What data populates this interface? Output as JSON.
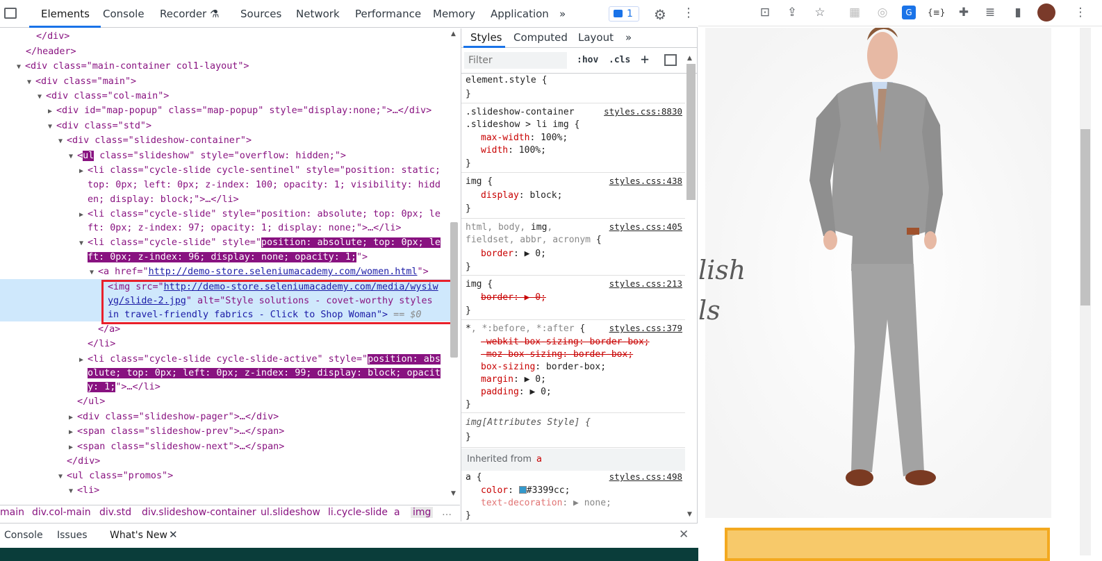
{
  "devtools": {
    "tabs": [
      "Elements",
      "Console",
      "Recorder",
      "Sources",
      "Network",
      "Performance",
      "Memory",
      "Application",
      "»"
    ],
    "issues_count": "1",
    "tree": [
      {
        "t": "</div>"
      },
      {
        "t": "</header>"
      },
      {
        "t": "<div class=\"main-container col1-layout\">"
      },
      {
        "t": "<div class=\"main\">"
      },
      {
        "t": "<div class=\"col-main\">"
      },
      {
        "t": "<div id=\"map-popup\" class=\"map-popup\" style=\"display:none;\">…</div>"
      },
      {
        "t": "<div class=\"std\">"
      },
      {
        "t": "<div class=\"slideshow-container\">"
      },
      {
        "t": "class=\"slideshow\" style=\"overflow: hidden;\">"
      },
      {
        "t": "<li class=\"cycle-slide cycle-sentinel\" style=\"position: static;"
      },
      {
        "t": "top: 0px; left: 0px; z-index: 100; opacity: 1; visibility: hidd"
      },
      {
        "t": "en; display: block;\">…</li>"
      },
      {
        "t": "<li class=\"cycle-slide\" style=\"position: absolute; top: 0px; le"
      },
      {
        "t": "ft: 0px; z-index: 97; opacity: 1; display: none;\">…</li>"
      },
      {
        "t": "<li class=\"cycle-slide\" style=\""
      },
      {
        "t": "position: absolute; top: 0px; le"
      },
      {
        "t": "ft: 0px; z-index: 96; display: none; opacity: 1;"
      },
      {
        "t": "<a href=\""
      },
      {
        "t": "http://demo-store.seleniumacademy.com/women.html"
      },
      {
        "t": "<img src=\""
      },
      {
        "t": "http://demo-store.seleniumacademy.com/media/wysiw"
      },
      {
        "t": "yg/slide-2.jpg"
      },
      {
        "t": "\" alt=\"Style solutions - covet-worthy styles"
      },
      {
        "t": "in travel-friendly fabrics - Click to Shop Woman\">"
      },
      {
        "t": "== $0"
      },
      {
        "t": "</a>"
      },
      {
        "t": "</li>"
      },
      {
        "t": "<li class=\"cycle-slide cycle-slide-active\" style=\""
      },
      {
        "t": "position: abs"
      },
      {
        "t": "olute; top: 0px; left: 0px; z-index: 99; display: block; opacit"
      },
      {
        "t": "y: 1;"
      },
      {
        "t": "\">…</li>"
      },
      {
        "t": "</ul>"
      },
      {
        "t": "<div class=\"slideshow-pager\">…</div>"
      },
      {
        "t": "<span class=\"slideshow-prev\">…</span>"
      },
      {
        "t": "<span class=\"slideshow-next\">…</span>"
      },
      {
        "t": "</div>"
      },
      {
        "t": "<ul class=\"promos\">"
      },
      {
        "t": "<li>"
      },
      {
        "t": "ul"
      }
    ],
    "breadcrumbs": [
      "main",
      "div.col-main",
      "div.std",
      "div.slideshow-container",
      "ul.slideshow",
      "li.cycle-slide",
      "a",
      "img",
      "…"
    ],
    "styles": {
      "subtabs": [
        "Styles",
        "Computed",
        "Layout",
        "»"
      ],
      "filter_placeholder": "Filter",
      "hov": ":hov",
      "cls": ".cls",
      "plus": "+",
      "rules": {
        "element_style": "element.style {",
        "close": "}",
        "r1_sel1": ".slideshow-container",
        "r1_sel2": ".slideshow > li img {",
        "r1_src": "styles.css:8830",
        "r1_p1": "max-width",
        "r1_v1": ": 100%;",
        "r1_p2": "width",
        "r1_v2": ": 100%;",
        "r2_sel": "img {",
        "r2_src": "styles.css:438",
        "r2_p1": "display",
        "r2_v1": ": block;",
        "r3_sel1a": "html, body, ",
        "r3_sel1b": "img",
        "r3_sel1c": ",",
        "r3_sel2": "fieldset, abbr, acronym",
        "r3_brace": " {",
        "r3_src": "styles.css:405",
        "r3_p1": "border",
        "r3_v1": ": ▶ 0;",
        "r4_sel": "img {",
        "r4_src": "styles.css:213",
        "r4_p1": "border: ▶ 0;",
        "r5_sel1": "*",
        "r5_sel2": ", *:before, *:after",
        "r5_brace": " {",
        "r5_src": "styles.css:379",
        "r5_p1": "-webkit-box-sizing: border-box;",
        "r5_p2": "-moz-box-sizing: border-box;",
        "r5_p3": "box-sizing",
        "r5_v3": ": border-box;",
        "r5_p4": "margin",
        "r5_v4": ": ▶ 0;",
        "r5_p5": "padding",
        "r5_v5": ": ▶ 0;",
        "r6_sel": "img[Attributes Style] {",
        "inherited": "Inherited from ",
        "inherited_el": "a",
        "r7_sel": "a {",
        "r7_src": "styles.css:498",
        "r7_p1": "color",
        "r7_v1": "#3399cc;",
        "r7_p2": "text-decoration",
        "r7_v2": ": ▶ none;"
      }
    },
    "drawer": [
      "Console",
      "Issues",
      "What's New"
    ]
  },
  "page": {
    "hero_line1": "lish",
    "hero_line2": "ls"
  },
  "colors": {
    "accent": "#1a73e8",
    "tag": "#881280",
    "attr": "#994500",
    "value": "#1a1aa6",
    "swatch": "#3399cc",
    "highlight": "#e8202a"
  }
}
